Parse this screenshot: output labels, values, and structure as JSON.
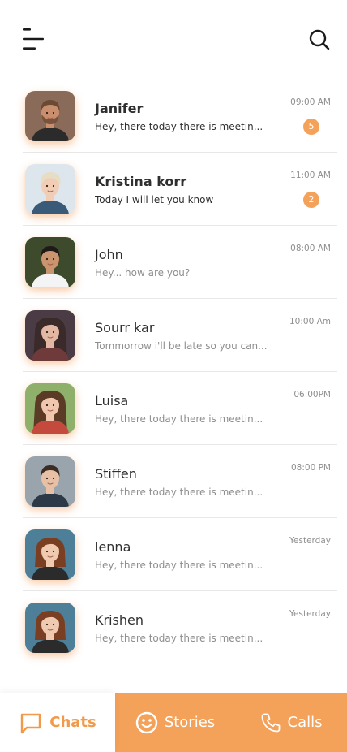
{
  "header": {
    "menu_icon": "menu-icon",
    "search_icon": "search-icon"
  },
  "chats": [
    {
      "name": "Janifer",
      "message": "Hey, there today there is meetin...",
      "time": "09:00 AM",
      "unread": "5",
      "avatar": {
        "skin": "#c98e6e",
        "hair": "#6b4a34",
        "bg": "#8a6a58",
        "clothes": "#2b2b2b",
        "type": "male-beard"
      }
    },
    {
      "name": "Kristina korr",
      "message": "Today I will let you know",
      "time": "11:00 AM",
      "unread": "2",
      "avatar": {
        "skin": "#f1cdb6",
        "hair": "#e7dcc4",
        "bg": "#dde6ec",
        "clothes": "#3a5a7a",
        "type": "female-short"
      }
    },
    {
      "name": "John",
      "message": "Hey... how are you?",
      "time": "08:00 AM",
      "unread": "",
      "avatar": {
        "skin": "#c9946e",
        "hair": "#1f1a17",
        "bg": "#3e4a2c",
        "clothes": "#f4f4f4",
        "type": "male"
      }
    },
    {
      "name": "Sourr kar",
      "message": "Tommorrow i'll be late so you can...",
      "time": "10:00 Am",
      "unread": "",
      "avatar": {
        "skin": "#e2b7a3",
        "hair": "#3a2a2a",
        "bg": "#4b3b44",
        "clothes": "#6f3a3a",
        "type": "female-long"
      }
    },
    {
      "name": "Luisa",
      "message": "Hey, there today there is meetin...",
      "time": "06:00PM",
      "unread": "",
      "avatar": {
        "skin": "#f0c7ae",
        "hair": "#5b3a26",
        "bg": "#8eb06a",
        "clothes": "#c44a3e",
        "type": "female-long"
      }
    },
    {
      "name": "Stiffen",
      "message": "Hey, there today there is meetin...",
      "time": "08:00 PM",
      "unread": "",
      "avatar": {
        "skin": "#e8c0a6",
        "hair": "#3b2c24",
        "bg": "#9aa4ad",
        "clothes": "#2e3948",
        "type": "male"
      }
    },
    {
      "name": "lenna",
      "message": "Hey, there today there is meetin...",
      "time": "Yesterday",
      "unread": "",
      "avatar": {
        "skin": "#f0c9b1",
        "hair": "#7a3f22",
        "bg": "#4e7f98",
        "clothes": "#2b2b2b",
        "type": "female-bob"
      }
    },
    {
      "name": "Krishen",
      "message": "Hey, there today there is meetin...",
      "time": "Yesterday",
      "unread": "",
      "avatar": {
        "skin": "#f0c9b1",
        "hair": "#7a3f22",
        "bg": "#4e7f98",
        "clothes": "#2b2b2b",
        "type": "female-bob"
      }
    }
  ],
  "nav": {
    "chats_label": "Chats",
    "stories_label": "Stories",
    "calls_label": "Calls",
    "active": "chats"
  },
  "colors": {
    "accent": "#f4a15a",
    "accent_text": "#f29a4b",
    "text_dark": "#2f2f2f",
    "text_muted": "#8e8e8e"
  }
}
